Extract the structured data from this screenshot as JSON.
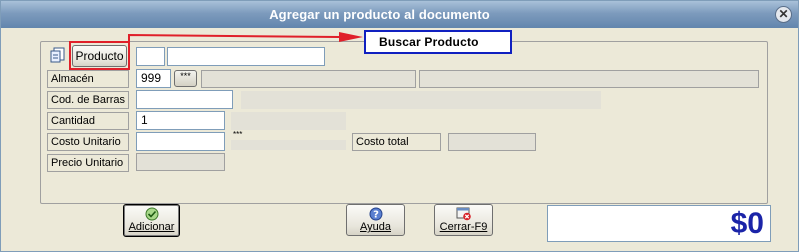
{
  "window": {
    "title": "Agregar un  producto al documento"
  },
  "callout": {
    "label": "Buscar Producto"
  },
  "form": {
    "producto_button": "Producto",
    "almacen_label": "Almacén",
    "almacen_value": "999",
    "almacen_lookup": "***",
    "barcode_label": "Cod. de Barras",
    "cantidad_label": "Cantidad",
    "cantidad_value": "1",
    "costo_unitario_label": "Costo Unitario",
    "costo_unitario_hint": "***",
    "costo_total_label": "Costo total",
    "precio_unitario_label": "Precio Unitario"
  },
  "buttons": {
    "adicionar": "Adicionar",
    "ayuda": "Ayuda",
    "cerrar": "Cerrar-F9"
  },
  "total": {
    "value": "$0"
  },
  "colors": {
    "highlight_red": "#e0202a",
    "callout_blue": "#1020c0",
    "total_blue": "#1b24a8"
  }
}
